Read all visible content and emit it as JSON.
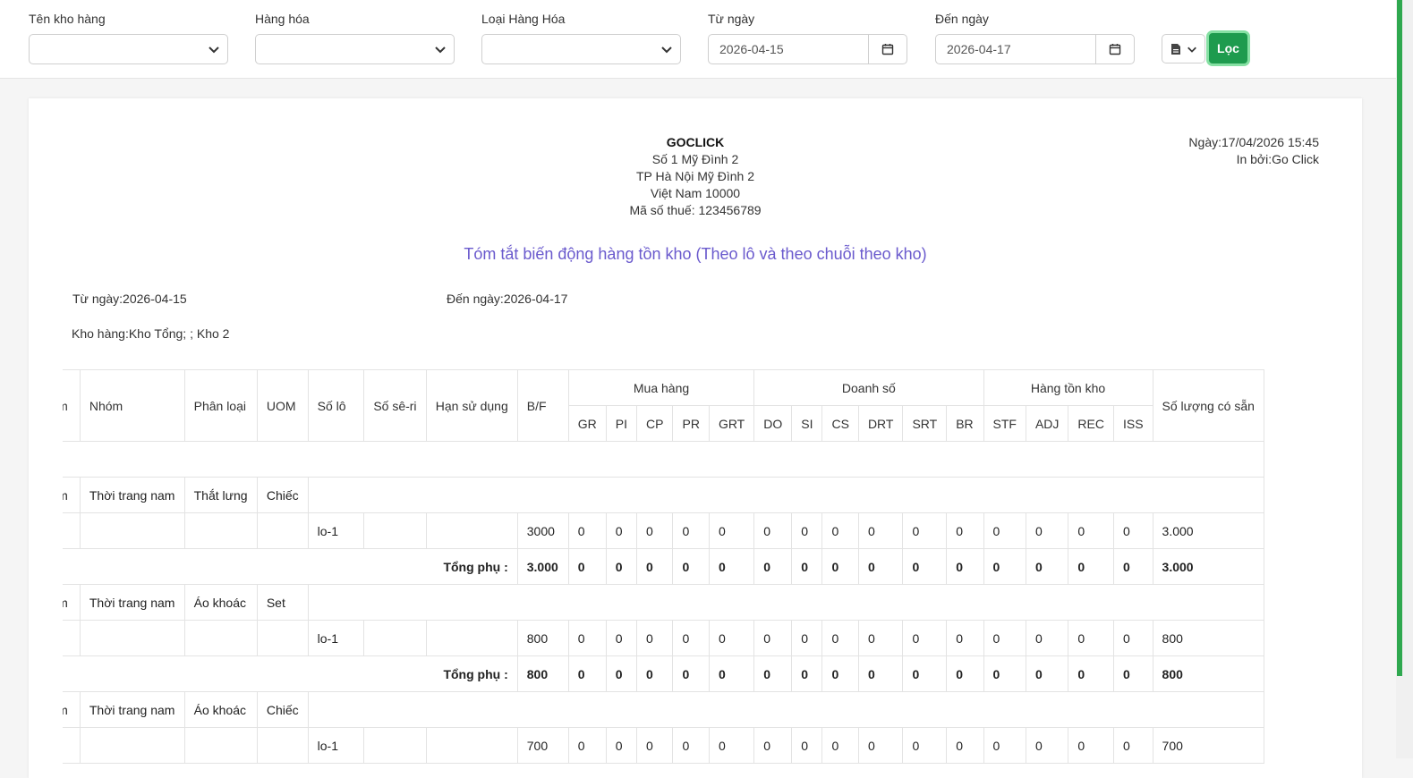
{
  "filters": {
    "warehouse_label": "Tên kho hàng",
    "goods_label": "Hàng hóa",
    "goods_type_label": "Loại Hàng Hóa",
    "from_label": "Từ ngày",
    "from_value": "2026-04-15",
    "to_label": "Đến ngày",
    "to_value": "2026-04-17",
    "filter_button": "Lọc"
  },
  "report": {
    "company_name": "GOCLICK",
    "address1": "Số 1 Mỹ Đình 2",
    "address2": "TP Hà Nội Mỹ Đình 2",
    "address3": "Việt Nam 10000",
    "tax": "Mã số thuế: 123456789",
    "print_date": "Ngày:17/04/2026 15:45",
    "printed_by": "In bởi:Go Click",
    "title": "Tóm tắt biến động hàng tồn kho (Theo lô và theo chuỗi theo kho)",
    "from": "Từ ngày:2026-04-15",
    "to": "Đến ngày:2026-04-17",
    "warehouse": "Kho hàng:Kho Tổng; ; Kho 2"
  },
  "table": {
    "headers": {
      "product": "Sản phẩm",
      "group": "Nhóm",
      "category": "Phân loại",
      "uom": "UOM",
      "lot": "Số lô",
      "serial": "Số sê-ri",
      "expiry": "Hạn sử dụng",
      "bf": "B/F",
      "purchase": "Mua hàng",
      "sales": "Doanh số",
      "inventory": "Hàng tồn kho",
      "available": "Số lượng có sẵn",
      "gr": "GR",
      "pi": "PI",
      "cp": "CP",
      "pr": "PR",
      "grt": "GRT",
      "do": "DO",
      "si": "SI",
      "cs": "CS",
      "drt": "DRT",
      "srt": "SRT",
      "br": "BR",
      "stf": "STF",
      "adj": "ADJ",
      "rec": "REC",
      "iss": "ISS"
    },
    "subtotal_label": "Tổng phụ :",
    "groups": [
      {
        "product": "Sản phẩm",
        "group": "Thời trang nam",
        "category": "Thắt lưng",
        "uom": "Chiếc",
        "lot": "lo-1",
        "bf": "3000",
        "vals": [
          "0",
          "0",
          "0",
          "0",
          "0",
          "0",
          "0",
          "0",
          "0",
          "0",
          "0",
          "0",
          "0",
          "0",
          "0"
        ],
        "available": "3.000",
        "sub_bf": "3.000",
        "sub_vals": [
          "0",
          "0",
          "0",
          "0",
          "0",
          "0",
          "0",
          "0",
          "0",
          "0",
          "0",
          "0",
          "0",
          "0",
          "0"
        ],
        "sub_available": "3.000"
      },
      {
        "product": "Sản phẩm",
        "group": "Thời trang nam",
        "category": "Áo khoác",
        "uom": "Set",
        "lot": "lo-1",
        "bf": "800",
        "vals": [
          "0",
          "0",
          "0",
          "0",
          "0",
          "0",
          "0",
          "0",
          "0",
          "0",
          "0",
          "0",
          "0",
          "0",
          "0"
        ],
        "available": "800",
        "sub_bf": "800",
        "sub_vals": [
          "0",
          "0",
          "0",
          "0",
          "0",
          "0",
          "0",
          "0",
          "0",
          "0",
          "0",
          "0",
          "0",
          "0",
          "0"
        ],
        "sub_available": "800"
      },
      {
        "product": "Sản phẩm",
        "group": "Thời trang nam",
        "category": "Áo khoác",
        "uom": "Chiếc",
        "lot": "lo-1",
        "bf": "700",
        "vals": [
          "0",
          "0",
          "0",
          "0",
          "0",
          "0",
          "0",
          "0",
          "0",
          "0",
          "0",
          "0",
          "0",
          "0",
          "0"
        ],
        "available": "700"
      }
    ]
  }
}
